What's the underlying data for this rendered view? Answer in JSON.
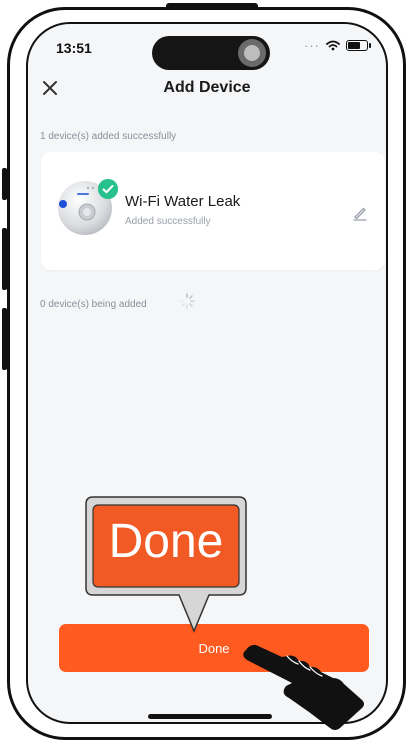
{
  "status_bar": {
    "time": "13:51",
    "dots": "···"
  },
  "header": {
    "title": "Add Device"
  },
  "added_section": {
    "label": "1 device(s) added successfully"
  },
  "device": {
    "name": "Wi-Fi Water Leak",
    "status": "Added successfully"
  },
  "adding_section": {
    "label": "0 device(s) being added"
  },
  "primary_button": {
    "label": "Done"
  },
  "annotation": {
    "callout_text": "Done"
  },
  "colors": {
    "accent": "#ff5a1f",
    "success": "#27c18e",
    "screen_bg": "#f5f6f8",
    "callout_bg": "#f15a24"
  },
  "icons": [
    "close-icon",
    "wifi-icon",
    "battery-icon",
    "check-icon",
    "pencil-icon",
    "spinner-icon",
    "hand-pointer-icon"
  ]
}
